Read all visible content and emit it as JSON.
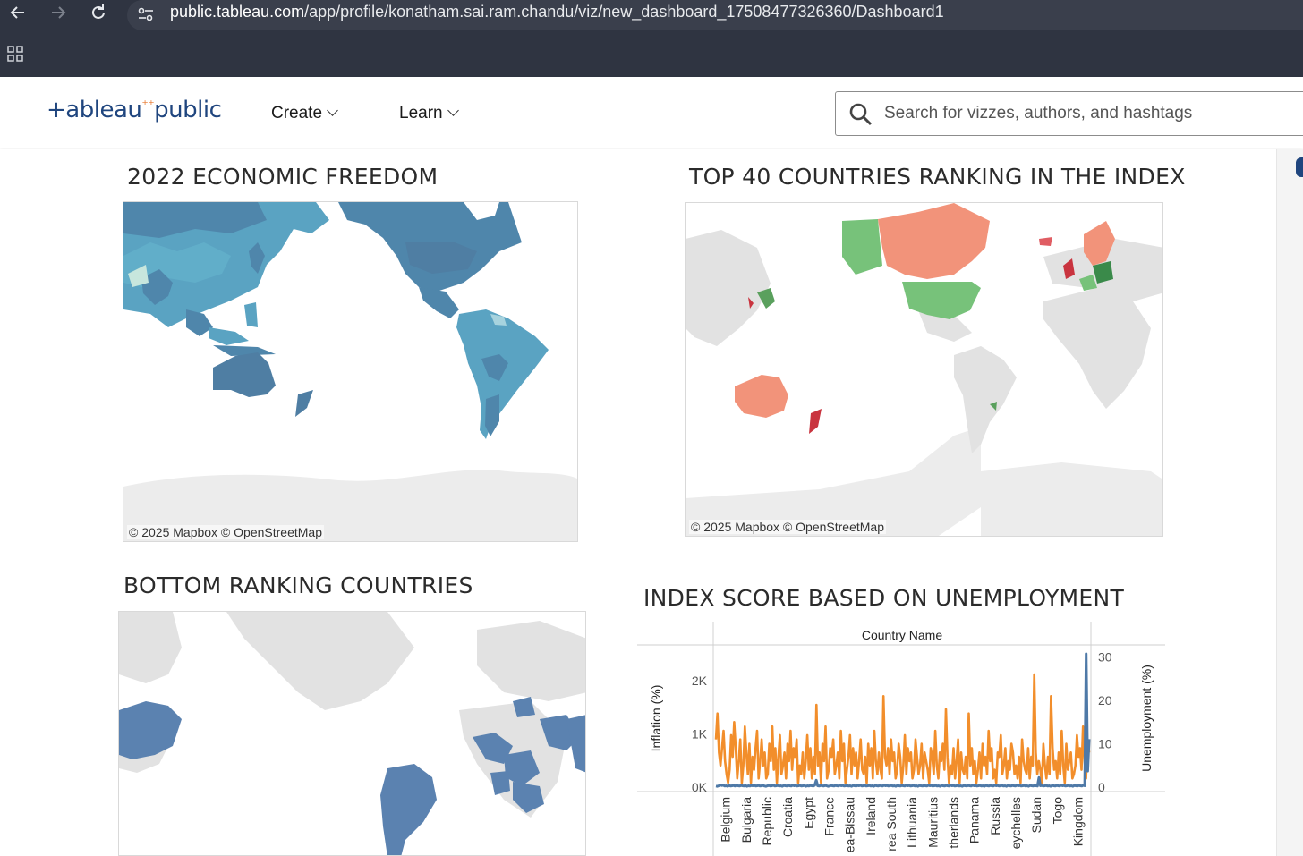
{
  "browser": {
    "url_host": "public.tableau.com",
    "url_path": "/app/profile/konatham.sai.ram.chandu/viz/new_dashboard_17508477326360/Dashboard1",
    "back_icon": "arrow-left-icon",
    "forward_icon": "arrow-right-icon",
    "reload_icon": "reload-icon",
    "site_info_icon": "tune-icon",
    "apps_icon": "grid-icon"
  },
  "header": {
    "logo_text_a": "+ableau",
    "logo_text_b": "public",
    "menu": [
      {
        "label": "Create"
      },
      {
        "label": "Learn"
      }
    ],
    "search_placeholder": "Search for vizzes, authors, and hashtags"
  },
  "dashboard": {
    "viz1": {
      "title": "2022 ECONOMIC FREEDOM",
      "attribution": "© 2025 Mapbox  © OpenStreetMap"
    },
    "viz2": {
      "title": "TOP 40 COUNTRIES RANKING IN THE INDEX",
      "attribution": "© 2025 Mapbox  © OpenStreetMap"
    },
    "viz3": {
      "title": "BOTTOM RANKING COUNTRIES"
    },
    "viz4": {
      "title": "INDEX SCORE BASED ON UNEMPLOYMENT"
    }
  },
  "colors": {
    "map_blue_dark": "#4f7ea3",
    "map_blue_mid": "#5b9cbf",
    "map_teal": "#64afc9",
    "top_green": "#77c27a",
    "top_salmon": "#f2937a",
    "top_red": "#d9534f",
    "gray_land": "#e2e2e2",
    "bottom_blue": "#5b82b0",
    "line_orange": "#f28e2b",
    "line_blue": "#4e79a7"
  },
  "chart_data": {
    "type": "line",
    "title": "INDEX SCORE BASED ON UNEMPLOYMENT",
    "column_header": "Country Name",
    "categories": [
      "Belgium",
      "Bulgaria",
      "Republic",
      "Croatia",
      "Egypt",
      "France",
      "ea-Bissau",
      "Ireland",
      "rea South",
      "Lithuania",
      "Mauritius",
      "therlands",
      "Panama",
      "Russia",
      "eychelles",
      "Sudan",
      "Togo",
      "Kingdom"
    ],
    "ylabel": "Inflation (%)",
    "ylabel_right": "Unemployment (%)",
    "y_ticks": [
      "2K",
      "1K",
      "0K"
    ],
    "y_values_for_ticks": [
      2000,
      1000,
      0
    ],
    "y_right_ticks": [
      "30",
      "20",
      "10",
      "0"
    ],
    "y_right_values_for_ticks": [
      30,
      20,
      10,
      0
    ],
    "ylim": [
      0,
      2600
    ],
    "ylim_right": [
      0,
      32
    ],
    "series": [
      {
        "name": "Unemployment (%)",
        "axis": "right",
        "values": [
          11,
          17,
          8,
          5,
          9,
          13,
          6,
          3,
          1,
          4,
          12,
          7,
          15,
          9,
          2,
          6,
          11,
          1,
          5,
          14,
          8,
          3,
          10,
          1,
          7,
          4,
          9,
          13,
          2,
          6,
          11,
          5,
          8,
          2,
          3,
          10,
          6,
          14,
          4,
          9,
          1,
          7,
          12,
          3,
          5,
          8,
          2,
          10,
          6,
          13,
          4,
          9,
          7,
          11,
          1,
          5,
          3,
          8,
          2,
          6,
          12,
          4,
          9,
          2,
          7,
          3,
          19,
          5,
          8,
          1,
          10,
          6,
          14,
          2,
          4,
          9,
          7,
          11,
          3,
          5,
          8,
          2,
          13,
          6,
          10,
          1,
          4,
          7,
          12,
          3,
          9,
          5,
          8,
          2,
          6,
          11,
          4,
          3,
          7,
          1,
          10,
          5,
          9,
          2,
          13,
          6,
          3,
          8,
          4,
          2,
          21,
          7,
          5,
          9,
          3,
          11,
          6,
          8,
          2,
          4,
          10,
          7,
          1,
          5,
          12,
          3,
          9,
          6,
          8,
          2,
          4,
          11,
          7,
          3,
          5,
          10,
          2,
          8,
          6,
          4,
          1,
          9,
          7,
          3,
          13,
          5,
          2,
          8,
          6,
          10,
          4,
          18,
          7,
          1,
          5,
          3,
          9,
          2,
          6,
          11,
          1,
          8,
          4,
          3,
          7,
          2,
          17,
          5,
          9,
          3,
          6,
          1,
          4,
          8,
          2,
          10,
          5,
          7,
          3,
          13,
          6,
          9,
          2,
          4,
          1,
          8,
          7,
          12,
          3,
          5,
          9,
          2,
          6,
          4,
          10,
          8,
          3,
          5,
          2,
          7,
          1,
          11,
          6,
          4,
          3,
          9,
          2,
          7,
          5,
          26,
          8,
          3,
          6,
          4,
          1,
          10,
          5,
          2,
          7,
          3,
          21,
          9,
          4,
          6,
          2,
          8,
          3,
          13,
          5,
          1,
          10,
          4,
          6,
          8,
          2,
          3,
          5,
          12,
          7,
          9,
          4,
          14,
          6,
          2,
          11,
          8
        ]
      },
      {
        "name": "Inflation (%)",
        "axis": "left",
        "values": [
          20,
          15,
          25,
          40,
          30,
          35,
          20,
          25,
          15,
          30,
          20,
          25,
          30,
          20,
          35,
          25,
          20,
          30,
          25,
          20,
          30,
          15,
          25,
          20,
          30,
          25,
          35,
          20,
          25,
          30,
          20,
          25,
          30,
          20,
          15,
          25,
          30,
          20,
          25,
          35,
          20,
          25,
          30,
          20,
          25,
          15,
          30,
          25,
          20,
          30,
          25,
          20,
          35,
          25,
          30,
          20,
          25,
          30,
          20,
          25,
          30,
          15,
          25,
          20,
          30,
          25,
          20,
          35,
          130,
          25,
          20,
          30,
          25,
          20,
          30,
          25,
          15,
          20,
          30,
          25,
          20,
          30,
          25,
          20,
          35,
          25,
          30,
          20,
          25,
          30,
          20,
          25,
          15,
          30,
          25,
          20,
          30,
          25,
          35,
          20,
          25,
          30,
          20,
          25,
          30,
          20,
          25,
          15,
          30,
          25,
          20,
          30,
          25,
          20,
          35,
          25,
          30,
          20,
          25,
          30,
          20,
          25,
          15,
          30,
          25,
          20,
          30,
          25,
          20,
          35,
          25,
          30,
          20,
          25,
          30,
          20,
          25,
          15,
          30,
          25,
          20,
          30,
          25,
          20,
          35,
          25,
          30,
          20,
          25,
          30,
          20,
          25,
          15,
          30,
          25,
          20,
          30,
          25,
          20,
          35,
          25,
          30,
          20,
          25,
          30,
          20,
          25,
          15,
          30,
          25,
          20,
          30,
          25,
          20,
          35,
          25,
          30,
          20,
          25,
          30,
          20,
          25,
          15,
          30,
          25,
          20,
          30,
          25,
          20,
          35,
          25,
          30,
          20,
          25,
          30,
          20,
          25,
          15,
          30,
          25,
          20,
          30,
          25,
          20,
          35,
          25,
          30,
          20,
          25,
          30,
          20,
          25,
          15,
          30,
          25,
          20,
          30,
          25,
          20,
          180,
          25,
          30,
          20,
          25,
          30,
          20,
          25,
          15,
          30,
          25,
          20,
          30,
          25,
          20,
          35,
          25,
          30,
          20,
          25,
          30,
          20,
          25,
          15,
          30,
          25,
          20,
          30,
          25,
          20,
          35,
          25,
          2500,
          300,
          900
        ]
      }
    ]
  }
}
